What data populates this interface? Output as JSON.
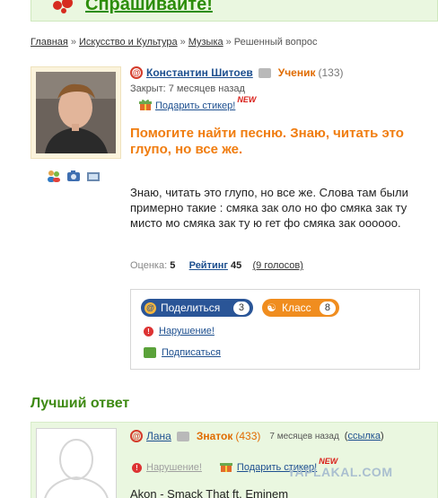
{
  "banner": {
    "text": "Спрашивайте!"
  },
  "breadcrumb": {
    "items": [
      "Главная",
      "Искусство и Культура",
      "Музыка"
    ],
    "separator": "»",
    "current": "Решенный вопрос"
  },
  "question": {
    "author": "Константин Шитоев",
    "rank": "Ученик",
    "rank_count": "(133)",
    "closed": "Закрыт: 7 месяцев назад",
    "gift_label": "Подарить стикер!",
    "new_badge": "NEW",
    "title": "Помогите найти песню. Знаю, читать это глупо, но все же.",
    "body": "Знаю, читать это глупо, но все же. Слова там были примерно такие : смяка зак оло но фо смяка зак ту мисто мо смяка зак ту ю гет фо смяка зак oooooo.",
    "score_label": "Оценка:",
    "score": "5",
    "rating_label": "Рейтинг",
    "rating": "45",
    "votes": "(9 голосов)"
  },
  "share": {
    "share_label": "Поделиться",
    "share_count": "3",
    "class_label": "Класс",
    "class_count": "8",
    "violation": "Нарушение!",
    "subscribe": "Подписаться"
  },
  "best_answer": {
    "heading": "Лучший ответ",
    "author": "Лана",
    "rank": "Знаток",
    "rank_count": "(433)",
    "time": "7 месяцев назад",
    "link_label": "ссылка",
    "violation": "Нарушение!",
    "gift_label": "Подарить стикер!",
    "new_badge": "NEW",
    "text": "Akon - Smack That ft. Eminem"
  },
  "watermark": "YAPLAKAL.COM",
  "colors": {
    "link": "#1d4f8f",
    "title_orange": "#f07d10",
    "rank_orange": "#e06b00",
    "best_green": "#3e8a13",
    "share_blue": "#2a5597",
    "class_orange": "#f08d1f"
  }
}
